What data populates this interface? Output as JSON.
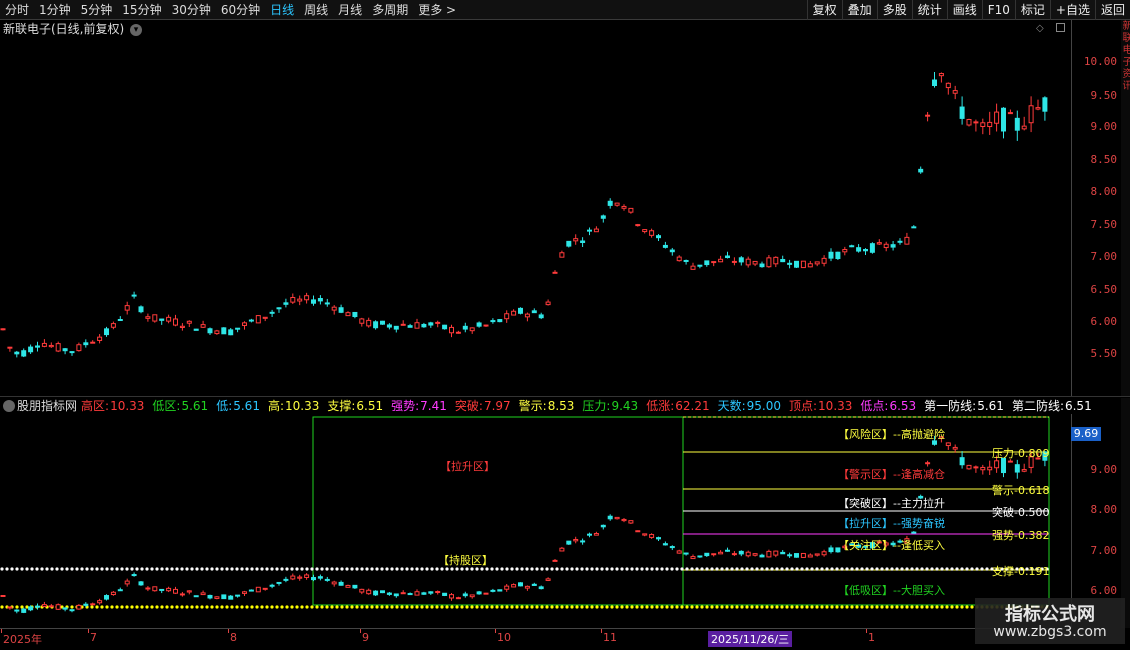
{
  "toolbar": {
    "periods": [
      "分时",
      "1分钟",
      "5分钟",
      "15分钟",
      "30分钟",
      "60分钟",
      "日线",
      "周线",
      "月线",
      "多周期",
      "更多 >"
    ],
    "active_period": "日线",
    "right_buttons": [
      "复权",
      "叠加",
      "多股",
      "统计",
      "画线",
      "F10",
      "标记",
      "+自选",
      "返回"
    ]
  },
  "main_panel": {
    "title": "新联电子(日线,前复权)",
    "price_labels": [
      "10.00",
      "9.50",
      "9.00",
      "8.50",
      "8.00",
      "7.50",
      "7.00",
      "6.50",
      "6.00",
      "5.50"
    ],
    "right_edge_text": "新联电子资讯"
  },
  "indicator": {
    "title": "股朋指标网",
    "fields": [
      {
        "label": "高区:",
        "value": "10.33",
        "color": "#ff3b3b"
      },
      {
        "label": "低区:",
        "value": "5.61",
        "color": "#21d321"
      },
      {
        "label": "低:",
        "value": "5.61",
        "color": "#2cc6ff"
      },
      {
        "label": "高:",
        "value": "10.33",
        "color": "#ffff40"
      },
      {
        "label": "支撑:",
        "value": "6.51",
        "color": "#ffff40"
      },
      {
        "label": "强势:",
        "value": "7.41",
        "color": "#ff3bff"
      },
      {
        "label": "突破:",
        "value": "7.97",
        "color": "#ff3b3b"
      },
      {
        "label": "警示:",
        "value": "8.53",
        "color": "#ffff40"
      },
      {
        "label": "压力:",
        "value": "9.43",
        "color": "#21d321"
      },
      {
        "label": "低涨:",
        "value": "62.21",
        "color": "#ff3b3b"
      },
      {
        "label": "天数:",
        "value": "95.00",
        "color": "#2cc6ff"
      },
      {
        "label": "顶点:",
        "value": "10.33",
        "color": "#ff3b3b"
      },
      {
        "label": "低点:",
        "value": "6.53",
        "color": "#ff3bff"
      },
      {
        "label": "第一防线:",
        "value": "5.61",
        "color": "#ffffff"
      },
      {
        "label": "第二防线:",
        "value": "6.51",
        "color": "#ffffff"
      }
    ],
    "price_labels": [
      "9.00",
      "8.00",
      "7.00",
      "6.00"
    ],
    "current_price": "9.69",
    "zone_lift": "【拉升区】",
    "zone_hold": "【持股区】",
    "zones": [
      {
        "label": "【风险区】--高抛避险",
        "color": "#ffff40"
      },
      {
        "label": "【警示区】--逢高减仓",
        "color": "#ff3b3b"
      },
      {
        "label": "【突破区】--主力拉升",
        "color": "#ffffff"
      },
      {
        "label": "【拉升区】--强势奋锐",
        "color": "#2cc6ff"
      },
      {
        "label": "【关注区】--逢低买入",
        "color": "#ffff40"
      },
      {
        "label": "【低吸区】--大胆买入",
        "color": "#21d321"
      }
    ],
    "fib": [
      {
        "label": "压力-0.809",
        "color": "#ffff40"
      },
      {
        "label": "警示-0.618",
        "color": "#ffff40"
      },
      {
        "label": "突破-0.500",
        "color": "#ffffff"
      },
      {
        "label": "强势-0.382",
        "color": "#ffff40"
      },
      {
        "label": "支撑-0.191",
        "color": "#ffff40"
      }
    ]
  },
  "xaxis": {
    "labels": [
      "2025年",
      "7",
      "8",
      "9",
      "10",
      "11",
      "1"
    ],
    "cursor_date": "2025/11/26/三"
  },
  "watermark": {
    "title": "指标公式网",
    "site": "www.zbgs3.com"
  }
}
